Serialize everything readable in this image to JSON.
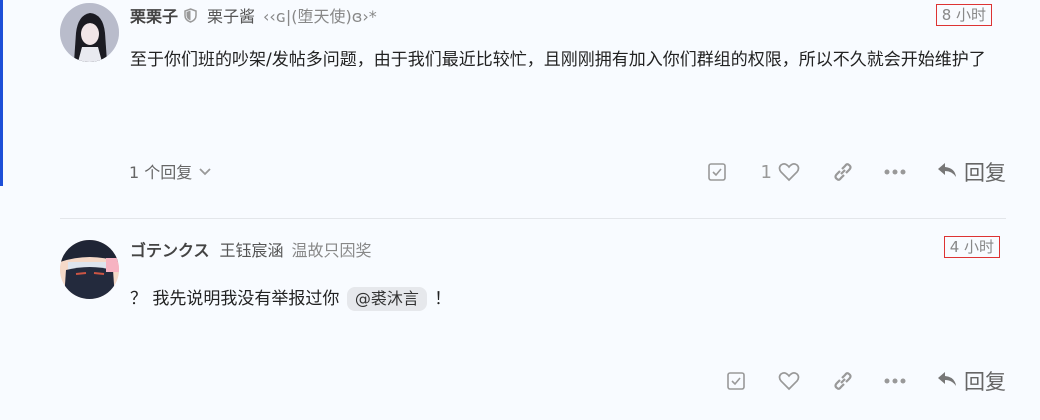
{
  "post1": {
    "username": "栗栗子",
    "full_name": "栗子酱",
    "user_title": "‹‹ɢ|(堕天使)ɞ›*",
    "timestamp": "8 小时",
    "body": "至于你们班的吵架/发帖多问题，由于我们最近比较忙，且刚刚拥有加入你们群组的权限，所以不久就会开始维护了",
    "replies_label": "1 个回复",
    "like_count": "1",
    "reply_label": "回复"
  },
  "post2": {
    "username": "ゴテンクス",
    "full_name": "王钰宸涵",
    "user_title": "温故只因奖",
    "timestamp": "4 小时",
    "body_before": "？ 我先说明我没有举报过你",
    "mention": "@裘沐言",
    "body_after": "！",
    "reply_label": "回复"
  }
}
